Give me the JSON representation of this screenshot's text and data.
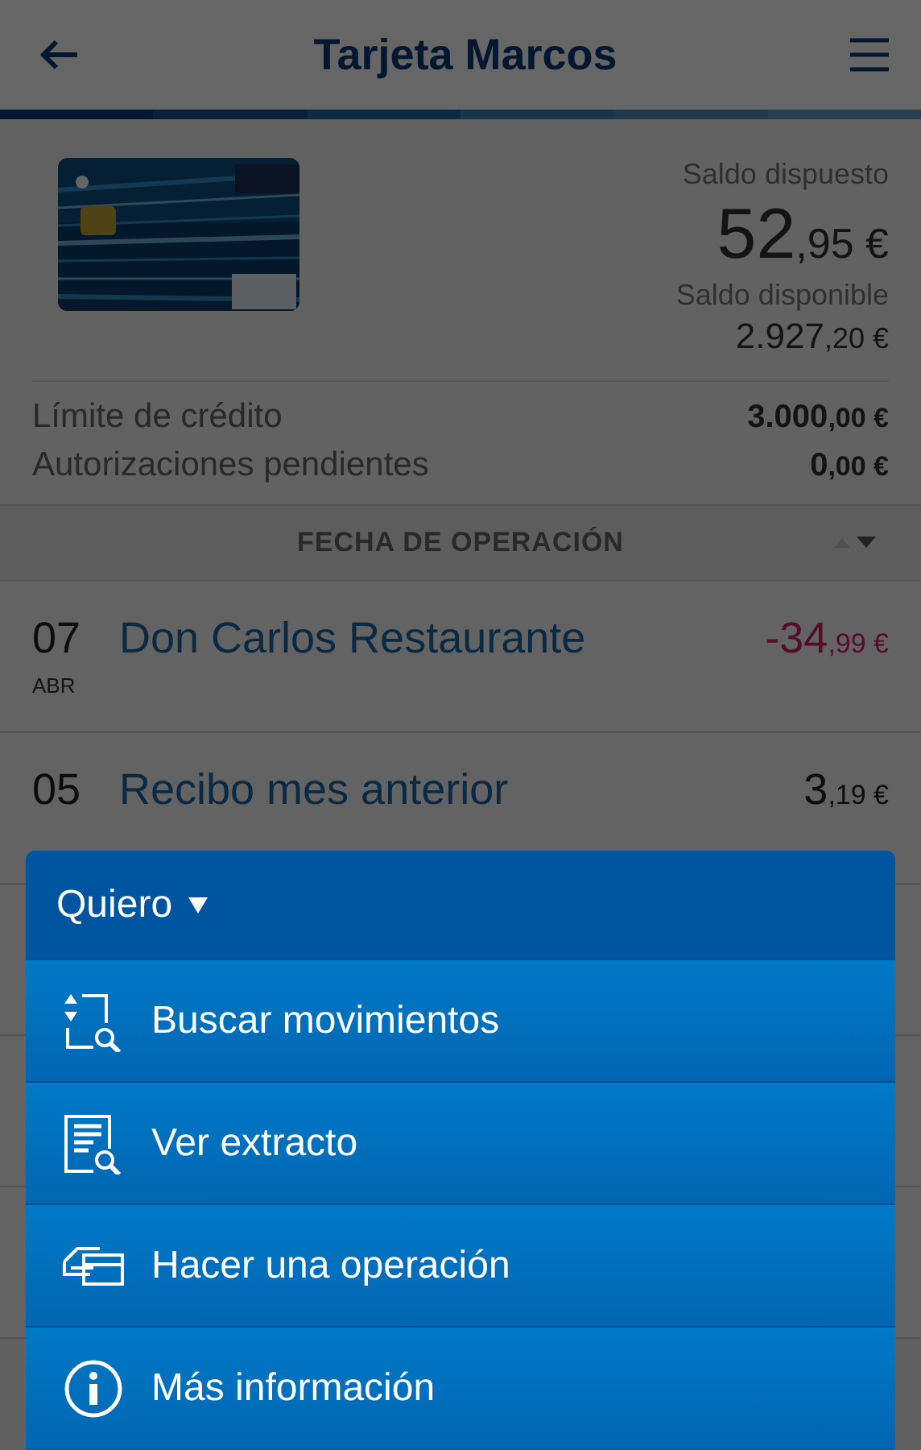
{
  "header": {
    "title": "Tarjeta Marcos"
  },
  "summary": {
    "spent_label": "Saldo dispuesto",
    "spent_int": "52",
    "spent_dec": ",95 €",
    "available_label": "Saldo disponible",
    "available_int": "2.927",
    "available_dec": ",20 €"
  },
  "limits": [
    {
      "label": "Límite de crédito",
      "int": "3.000",
      "dec": ",00 €"
    },
    {
      "label": "Autorizaciones pendientes",
      "int": "0",
      "dec": ",00 €"
    }
  ],
  "sort_header": {
    "label": "FECHA DE OPERACIÓN",
    "descending": true
  },
  "movements": [
    {
      "day": "07",
      "month": "ABR",
      "concept": "Don Carlos Restaurante",
      "int": "-34",
      "dec": ",99 €",
      "kind": "charge"
    },
    {
      "day": "05",
      "concept": "Recibo mes anterior",
      "int": "3",
      "dec": ",19 €",
      "kind": "credit"
    }
  ],
  "sheet": {
    "title": "Quiero",
    "items": [
      {
        "label": "Buscar movimientos",
        "kind": "search"
      },
      {
        "label": "Ver extracto",
        "kind": "statement"
      },
      {
        "label": "Hacer una operación",
        "kind": "operation"
      },
      {
        "label": "Más información",
        "kind": "info"
      }
    ]
  }
}
